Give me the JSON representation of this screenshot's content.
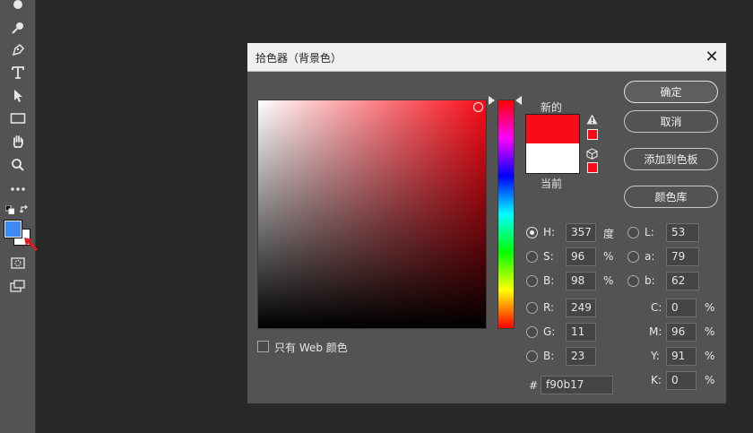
{
  "dialog": {
    "title": "拾色器（背景色）",
    "close_glyph": "✕"
  },
  "swatch": {
    "new_label": "新的",
    "current_label": "当前",
    "new_color": "#f90b17",
    "current_color": "#ffffff"
  },
  "buttons": {
    "ok": "确定",
    "cancel": "取消",
    "add_to_swatches": "添加到色板",
    "color_libraries": "颜色库"
  },
  "web_only": {
    "label": "只有 Web 颜色",
    "checked": false
  },
  "hsb": {
    "h": {
      "label": "H:",
      "value": "357",
      "unit": "度",
      "selected": true
    },
    "s": {
      "label": "S:",
      "value": "96",
      "unit": "%",
      "selected": false
    },
    "b": {
      "label": "B:",
      "value": "98",
      "unit": "%",
      "selected": false
    }
  },
  "rgb": {
    "r": {
      "label": "R:",
      "value": "249",
      "selected": false
    },
    "g": {
      "label": "G:",
      "value": "11",
      "selected": false
    },
    "b": {
      "label": "B:",
      "value": "23",
      "selected": false
    }
  },
  "lab": {
    "l": {
      "label": "L:",
      "value": "53",
      "selected": false
    },
    "a": {
      "label": "a:",
      "value": "79",
      "selected": false
    },
    "b": {
      "label": "b:",
      "value": "62",
      "selected": false
    }
  },
  "cmyk": {
    "c": {
      "label": "C:",
      "value": "0",
      "unit": "%"
    },
    "m": {
      "label": "M:",
      "value": "96",
      "unit": "%"
    },
    "y": {
      "label": "Y:",
      "value": "91",
      "unit": "%"
    },
    "k": {
      "label": "K:",
      "value": "0",
      "unit": "%"
    }
  },
  "hex": {
    "label": "#",
    "value": "f90b17"
  },
  "toolbar": {
    "tools": [
      "brush-tool-icon",
      "spot-healing-icon",
      "pen-tool-icon",
      "type-tool-icon",
      "path-selection-icon",
      "rectangle-tool-icon",
      "hand-tool-icon",
      "zoom-tool-icon",
      "more-tools-icon"
    ],
    "foreground_color": "#3d8bf2",
    "background_color": "#ffffff"
  }
}
